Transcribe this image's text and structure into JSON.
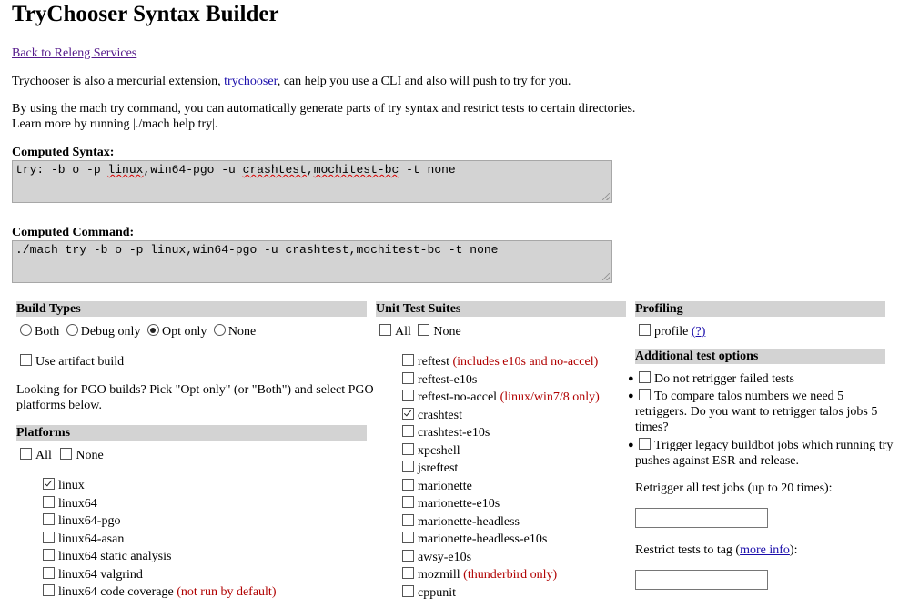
{
  "page": {
    "title": "TryChooser Syntax Builder",
    "back_link": "Back to Releng Services",
    "intro_before": "Trychooser is also a mercurial extension, ",
    "intro_link": "trychooser",
    "intro_after": ", can help you use a CLI and also will push to try for you.",
    "mach_line1": "By using the mach try command, you can automatically generate parts of try syntax and restrict tests to certain directories.",
    "mach_line2": "Learn more by running |./mach help try|."
  },
  "computed_syntax": {
    "label": "Computed Syntax:",
    "prefix": "try: -b o -p ",
    "w1": "linux",
    "mid": ",win64-pgo -u ",
    "w2": "crashtest",
    "comma": ",",
    "w3": "mochitest-bc",
    "suffix": " -t none"
  },
  "computed_command": {
    "label": "Computed Command:",
    "value": "./mach try -b o -p linux,win64-pgo -u crashtest,mochitest-bc -t none"
  },
  "build_types": {
    "header": "Build Types",
    "options": [
      {
        "label": "Both",
        "selected": false
      },
      {
        "label": "Debug only",
        "selected": false
      },
      {
        "label": "Opt only",
        "selected": true
      },
      {
        "label": "None",
        "selected": false
      }
    ],
    "artifact_label": "Use artifact build",
    "pgo_note_line1": "Looking for PGO builds? Pick \"Opt only\" (or \"Both\") and select PGO",
    "pgo_note_line2": "platforms below."
  },
  "platforms": {
    "header": "Platforms",
    "all_label": "All",
    "none_label": "None",
    "items": [
      {
        "label": "linux",
        "checked": true,
        "note": ""
      },
      {
        "label": "linux64",
        "checked": false,
        "note": ""
      },
      {
        "label": "linux64-pgo",
        "checked": false,
        "note": ""
      },
      {
        "label": "linux64-asan",
        "checked": false,
        "note": ""
      },
      {
        "label": "linux64 static analysis",
        "checked": false,
        "note": ""
      },
      {
        "label": "linux64 valgrind",
        "checked": false,
        "note": ""
      },
      {
        "label": "linux64 code coverage",
        "checked": false,
        "note": "(not run by default)"
      }
    ]
  },
  "unit_tests": {
    "header": "Unit Test Suites",
    "all_label": "All",
    "none_label": "None",
    "items": [
      {
        "label": "reftest",
        "checked": false,
        "note": "(includes e10s and no-accel)"
      },
      {
        "label": "reftest-e10s",
        "checked": false,
        "note": ""
      },
      {
        "label": "reftest-no-accel",
        "checked": false,
        "note": "(linux/win7/8 only)"
      },
      {
        "label": "crashtest",
        "checked": true,
        "note": ""
      },
      {
        "label": "crashtest-e10s",
        "checked": false,
        "note": ""
      },
      {
        "label": "xpcshell",
        "checked": false,
        "note": ""
      },
      {
        "label": "jsreftest",
        "checked": false,
        "note": ""
      },
      {
        "label": "marionette",
        "checked": false,
        "note": ""
      },
      {
        "label": "marionette-e10s",
        "checked": false,
        "note": ""
      },
      {
        "label": "marionette-headless",
        "checked": false,
        "note": ""
      },
      {
        "label": "marionette-headless-e10s",
        "checked": false,
        "note": ""
      },
      {
        "label": "awsy-e10s",
        "checked": false,
        "note": ""
      },
      {
        "label": "mozmill",
        "checked": false,
        "note": "(thunderbird only)"
      },
      {
        "label": "cppunit",
        "checked": false,
        "note": ""
      }
    ]
  },
  "profiling": {
    "header": "Profiling",
    "profile_label": "profile",
    "help_link": "(?)"
  },
  "additional": {
    "header": "Additional test options",
    "opt1": "Do not retrigger failed tests",
    "opt2_line1": "To compare talos numbers we need 5",
    "opt2_line2": "retriggers. Do you want to retrigger talos jobs 5",
    "opt2_line3": "times?",
    "opt3_line1": "Trigger legacy buildbot jobs which running try",
    "opt3_line2": "pushes against ESR and release.",
    "retrigger_label": "Retrigger all test jobs (up to 20 times):",
    "retrigger_value": "",
    "restrict_before": "Restrict tests to tag (",
    "restrict_link": "more info",
    "restrict_after": "):",
    "restrict_value": ""
  }
}
